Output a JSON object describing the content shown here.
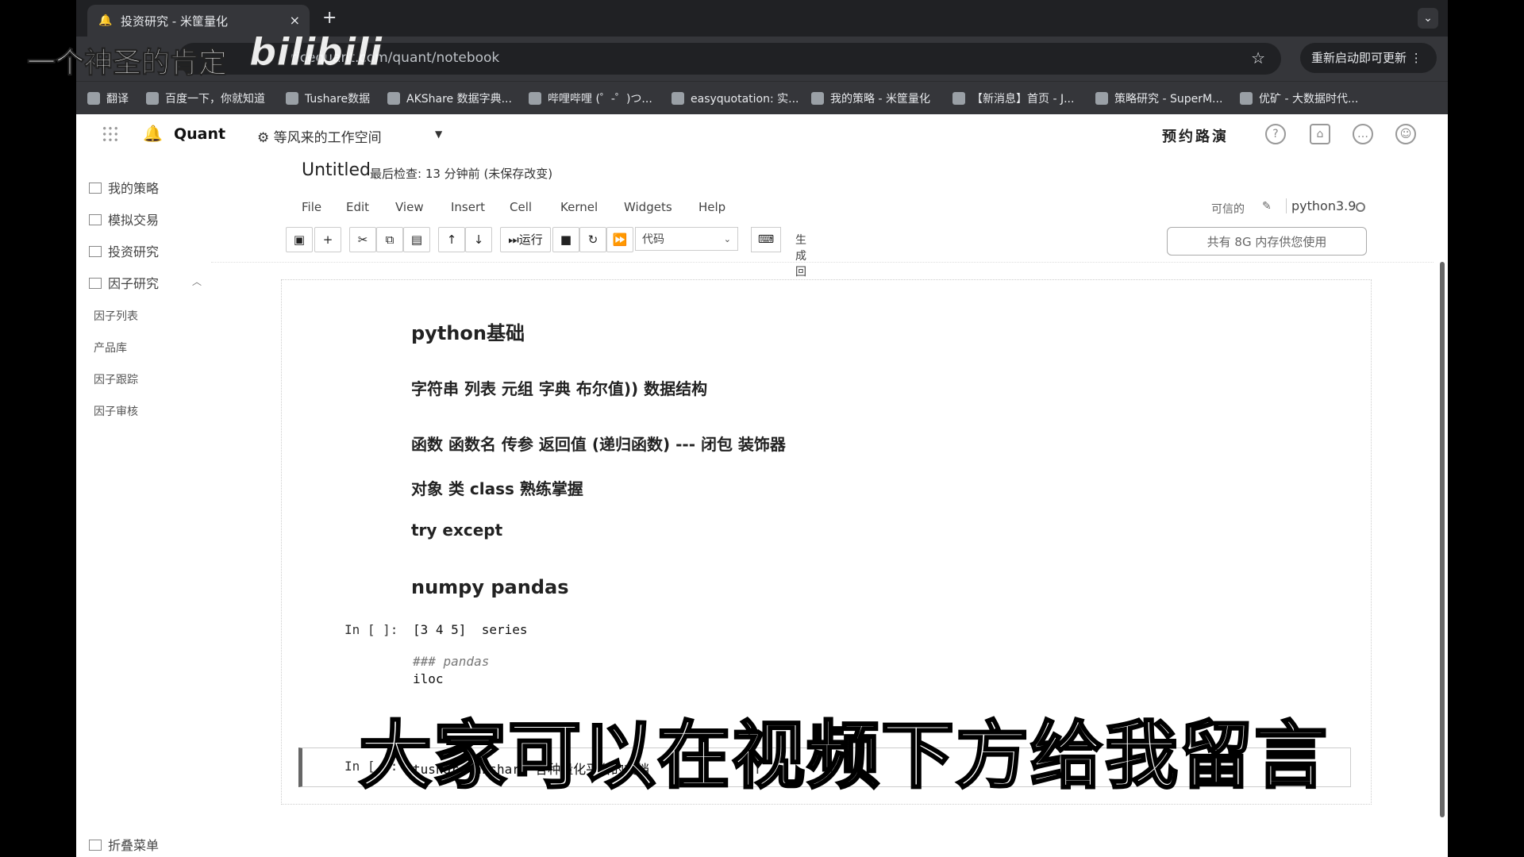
{
  "browser": {
    "tab_title": "投资研究 - 米筐量化",
    "tab_close": "×",
    "new_tab": "+",
    "url": "ricequant.com/quant/notebook",
    "update_button": "重新启动即可更新 ⋮"
  },
  "bookmarks": [
    "翻译",
    "百度一下，你就知道",
    "Tushare数据",
    "AKShare 数据字典...",
    "哔哩哔哩 (゜-゜)つ...",
    "easyquotation: 实...",
    "我的策略 - 米筐量化",
    "【新消息】首页 - J...",
    "策略研究 - SuperM...",
    "优矿 - 大数据时代..."
  ],
  "app": {
    "brand": "Quant",
    "workspace": "等风来的工作空间",
    "reserve": "预约路演"
  },
  "sidebar": {
    "items": [
      "我的策略",
      "模拟交易",
      "投资研究",
      "因子研究"
    ],
    "sub_items": [
      "因子列表",
      "产品库",
      "因子跟踪",
      "因子审核"
    ],
    "collapse": "折叠菜单"
  },
  "notebook": {
    "title": "Untitled",
    "meta": "最后检查: 13 分钟前  (未保存改变)",
    "menu": [
      "File",
      "Edit",
      "View",
      "Insert",
      "Cell",
      "Kernel",
      "Widgets",
      "Help"
    ],
    "trusted": "可信的",
    "kernel": "python3.9",
    "run_label": "运行",
    "cell_type": "代码",
    "template_label": "生成回测代码模板",
    "memory": "共有 8G 内存供您使用"
  },
  "cells": {
    "md1": "python基础",
    "md2": "字符串 列表 元组 字典 布尔值)) 数据结构",
    "md3": "函数 函数名 传参 返回值 (递归函数) --- 闭包 装饰器",
    "md4": "对象 类 class 熟练掌握",
    "md5": "try except",
    "md6": "numpy pandas",
    "prompt1": "In [ ]:",
    "code1_line1": "[3 4 5]  series",
    "code1_comment": "### pandas",
    "code1_line3": "iloc",
    "prompt2": "In [ ]:",
    "code2": "tushare akshare 各种量化平台的文档"
  },
  "overlay": {
    "watermark_text": "一个神圣的肯定",
    "watermark_logo": "bilibili",
    "subtitle": "大家可以在视频下方给我留言"
  }
}
